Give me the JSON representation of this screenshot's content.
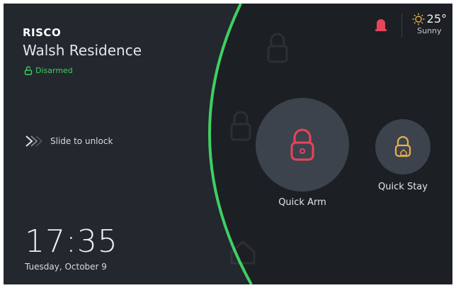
{
  "brand": {
    "logo": "RISCO"
  },
  "home": {
    "name": "Walsh Residence",
    "status": "Disarmed"
  },
  "slide": {
    "label": "Slide to unlock"
  },
  "clock": {
    "time": "17:35",
    "date": "Tuesday, October 9"
  },
  "weather": {
    "temperature": "25°",
    "condition": "Sunny",
    "icon": "sun-icon"
  },
  "header": {
    "alarm_icon": "siren-icon"
  },
  "actions": [
    {
      "label": "Quick Arm",
      "icon": "lock-icon"
    },
    {
      "label": "Quick Stay",
      "icon": "home-lock-icon"
    }
  ],
  "colors": {
    "accent": "#3fcf63",
    "arm": "#e8445a",
    "stay": "#e8b04d",
    "background": "#23272e"
  }
}
